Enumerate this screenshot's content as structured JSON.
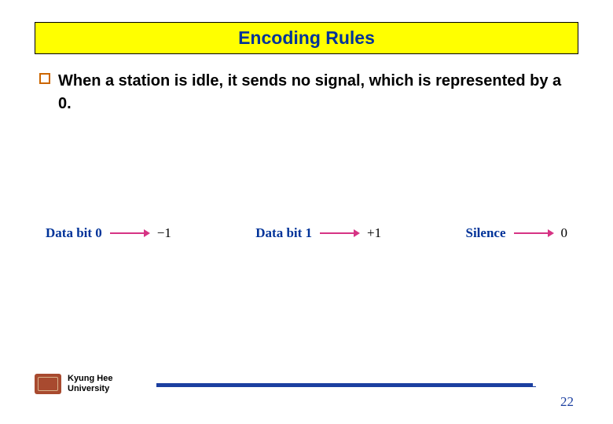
{
  "title": "Encoding Rules",
  "bullet": "When a station is idle, it sends no signal, which is represented by a 0.",
  "encoding": {
    "item1": {
      "label": "Data bit 0",
      "value": "−1"
    },
    "item2": {
      "label": "Data bit 1",
      "value": "+1"
    },
    "item3": {
      "label": "Silence",
      "value": "0"
    }
  },
  "footer": {
    "university_line1": "Kyung Hee",
    "university_line2": "University",
    "page_number": "22"
  }
}
